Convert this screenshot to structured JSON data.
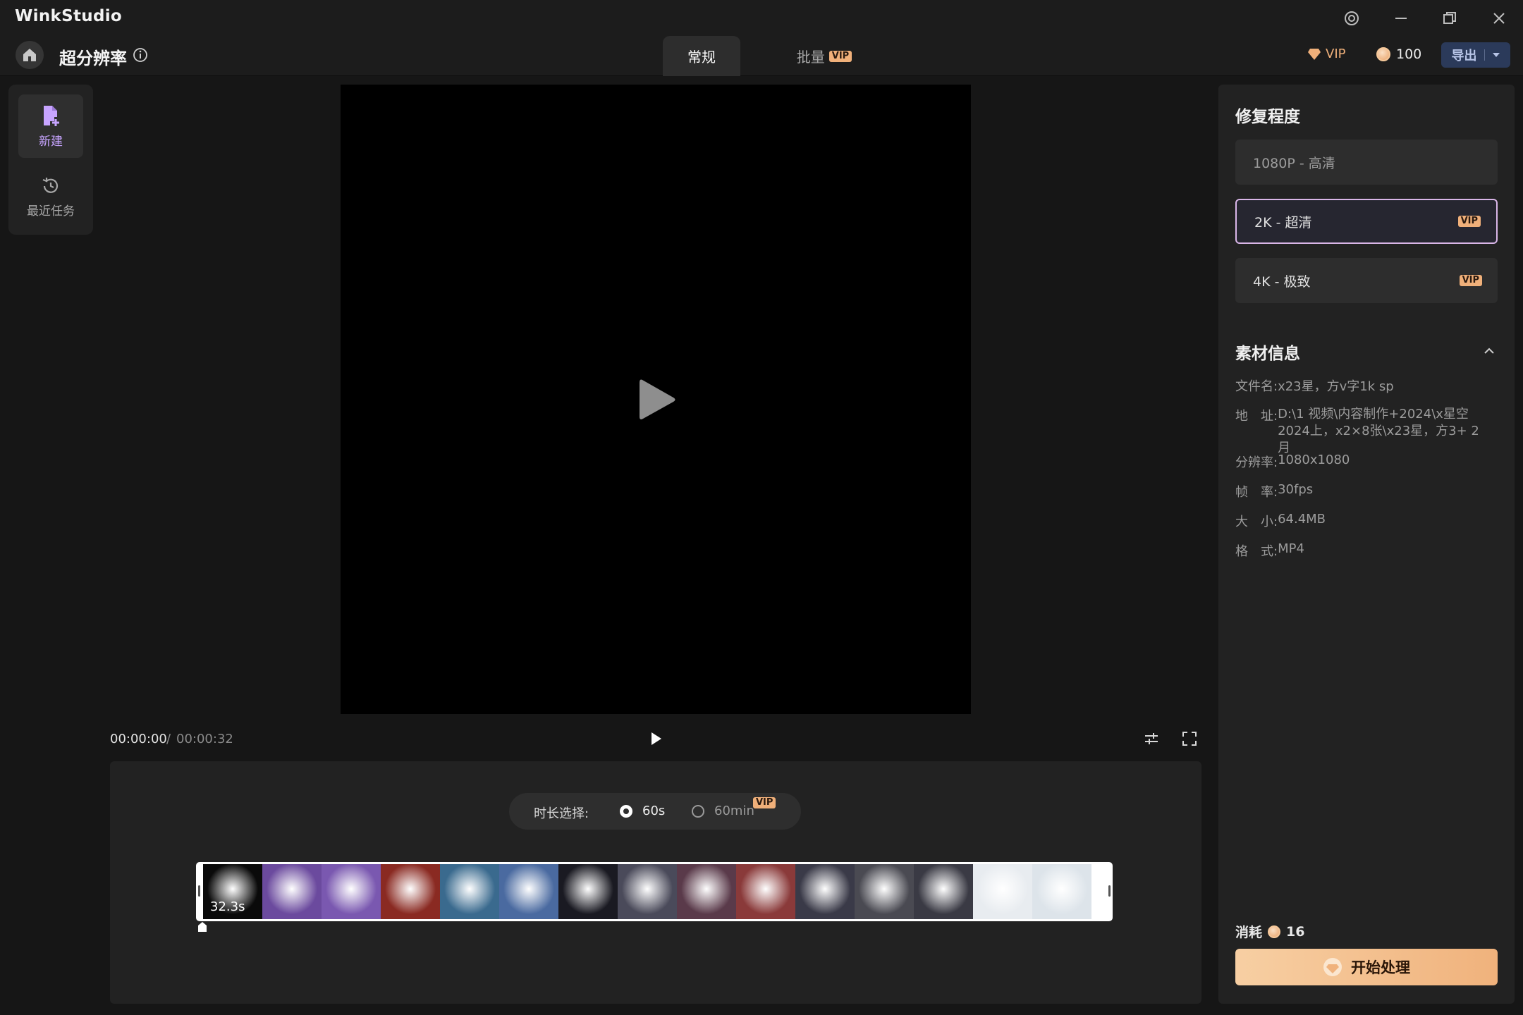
{
  "app": {
    "name": "WinkStudio"
  },
  "header": {
    "page_title": "超分辨率",
    "tabs": [
      {
        "label": "常规",
        "active": true
      },
      {
        "label": "批量",
        "badge": "VIP",
        "active": false
      }
    ],
    "vip_label": "VIP",
    "coin_balance": "100",
    "export_label": "导出"
  },
  "sidebar": {
    "items": [
      {
        "label": "新建",
        "icon": "new-file-icon",
        "active": true
      },
      {
        "label": "最近任务",
        "icon": "history-icon",
        "active": false
      }
    ]
  },
  "player": {
    "current_time": "00:00:00",
    "separator": "/",
    "total_time": "00:00:32"
  },
  "timeline": {
    "duration_label": "时长选择:",
    "options": [
      {
        "label": "60s",
        "selected": true
      },
      {
        "label": "60min",
        "badge": "VIP",
        "selected": false
      }
    ],
    "clip_duration": "32.3s",
    "frames": [
      "#0a0a0a",
      "#6b4a9e",
      "#7a58b0",
      "#8a2a22",
      "#3a6a8e",
      "#4a6aa0",
      "#1a1a22",
      "#4a4a5a",
      "#5a3a4a",
      "#8a3a3a",
      "#3a3a48",
      "#4a4a52",
      "#3a3a44",
      "#e8ecf0",
      "#dde4ea"
    ]
  },
  "right_panel": {
    "repair_title": "修复程度",
    "qualities": [
      {
        "label": "1080P - 高清",
        "vip": "",
        "selected": false
      },
      {
        "label": "2K - 超清",
        "vip": "VIP",
        "selected": true
      },
      {
        "label": "4K - 极致",
        "vip": "VIP",
        "selected": false
      }
    ],
    "info_title": "素材信息",
    "info": {
      "filename_key": "文件名:",
      "filename": "x23星，方v字1k sp",
      "path_key": "地　址:",
      "path": "D:\\1 视频\\内容制作+2024\\x星空2024上，x2×8张\\x23星，方3+ 2月",
      "resolution_key": "分辨率:",
      "resolution": "1080x1080",
      "fps_key": "帧　率:",
      "fps": "30fps",
      "size_key": "大　小:",
      "size": "64.4MB",
      "format_key": "格　式:",
      "format": "MP4"
    },
    "cost_label": "消耗",
    "cost_value": "16",
    "start_label": "开始处理"
  },
  "colors": {
    "accent_vip": "#f0b07a",
    "accent_purple": "#c7a4ff",
    "selected_border": "#d9b6e8"
  }
}
